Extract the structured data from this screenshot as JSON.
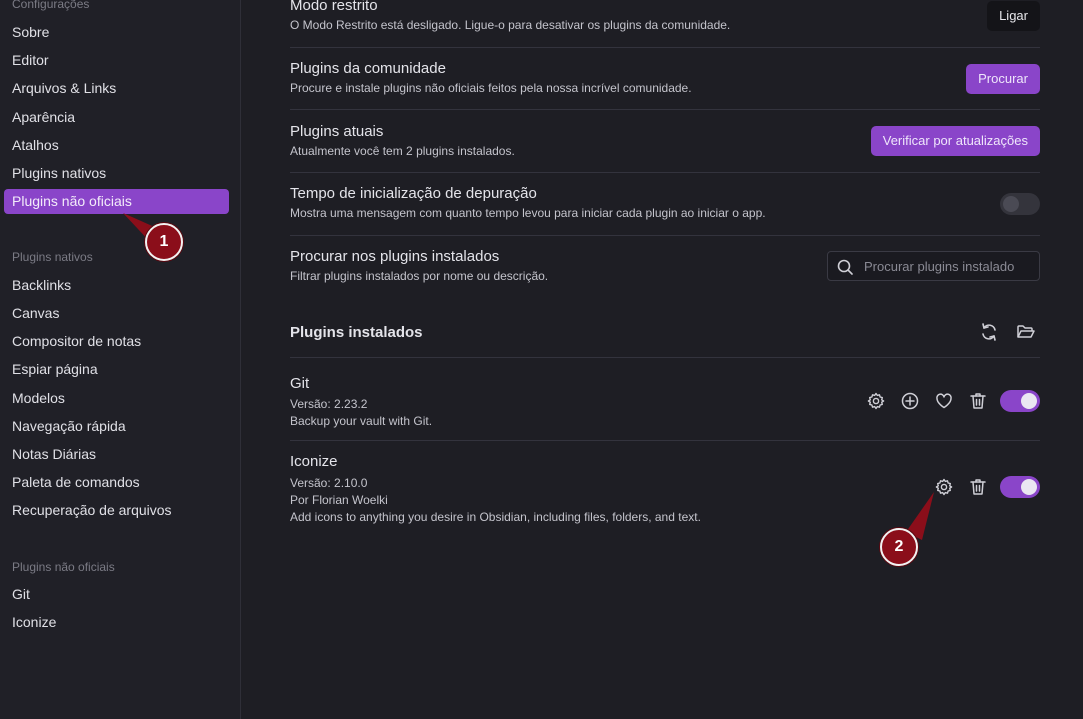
{
  "sidebar": {
    "groups": [
      {
        "title": "Configurações",
        "items": [
          "Sobre",
          "Editor",
          "Arquivos & Links",
          "Aparência",
          "Atalhos",
          "Plugins nativos",
          "Plugins não oficiais"
        ]
      },
      {
        "title": "Plugins nativos",
        "items": [
          "Backlinks",
          "Canvas",
          "Compositor de notas",
          "Espiar página",
          "Modelos",
          "Navegação rápida",
          "Notas Diárias",
          "Paleta de comandos",
          "Recuperação de arquivos"
        ]
      },
      {
        "title": "Plugins não oficiais",
        "items": [
          "Git",
          "Iconize"
        ]
      }
    ],
    "active_item": "Plugins não oficiais"
  },
  "settings": {
    "restricted": {
      "name": "Modo restrito",
      "desc": "O Modo Restrito está desligado. Ligue-o para desativar os plugins da comunidade.",
      "button": "Ligar"
    },
    "community": {
      "name": "Plugins da comunidade",
      "desc": "Procure e instale plugins não oficiais feitos pela nossa incrível comunidade.",
      "button": "Procurar"
    },
    "current": {
      "name": "Plugins atuais",
      "desc": "Atualmente você tem 2 plugins instalados.",
      "button": "Verificar por atualizações"
    },
    "debug": {
      "name": "Tempo de inicialização de depuração",
      "desc": "Mostra uma mensagem com quanto tempo levou para iniciar cada plugin ao iniciar o app.",
      "enabled": false
    },
    "search": {
      "name": "Procurar nos plugins instalados",
      "desc": "Filtrar plugins instalados por nome ou descrição.",
      "placeholder": "Procurar plugins instalado"
    }
  },
  "installed": {
    "title": "Plugins instalados",
    "plugins": [
      {
        "name": "Git",
        "version": "Versão: 2.23.2",
        "desc": "Backup your vault with Git.",
        "enabled": true
      },
      {
        "name": "Iconize",
        "version": "Versão: 2.10.0",
        "author": "Por Florian Woelki",
        "desc": "Add icons to anything you desire in Obsidian, including files, folders, and text.",
        "enabled": true
      }
    ]
  },
  "callouts": [
    "1",
    "2"
  ],
  "colors": {
    "accent": "#8a45c9",
    "background": "#1e1e24",
    "sidebar": "#202027",
    "callout": "#8b0e1a"
  },
  "icons": [
    "search-icon",
    "reload-icon",
    "folder-open-icon",
    "gear-icon",
    "plus-circle-icon",
    "heart-icon",
    "trash-icon"
  ]
}
